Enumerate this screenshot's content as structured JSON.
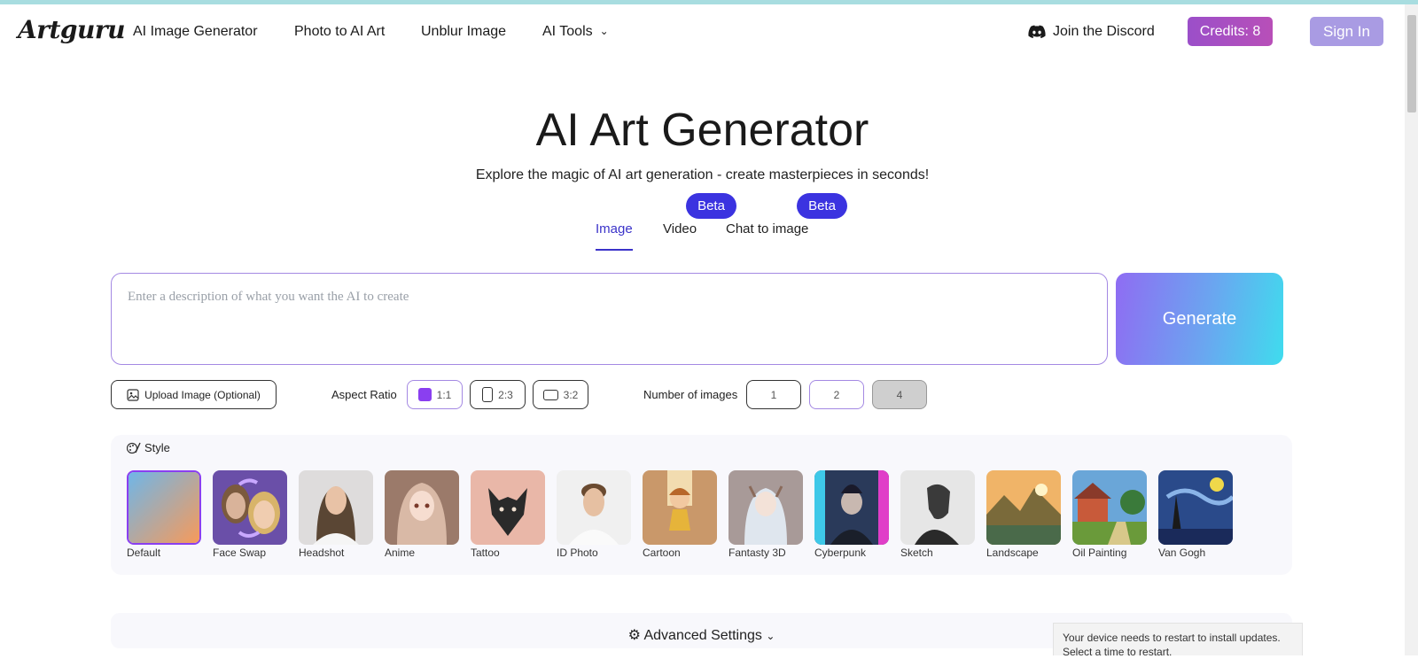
{
  "header": {
    "logo": "Artguru",
    "nav": [
      "AI Image Generator",
      "Photo to AI Art",
      "Unblur Image",
      "AI Tools"
    ],
    "discord_label": "Join the Discord",
    "credits_label": "Credits: 8",
    "signin_label": "Sign In"
  },
  "hero": {
    "title": "AI Art Generator",
    "subtitle": "Explore the magic of AI art generation - create masterpieces in seconds!"
  },
  "tabs": [
    {
      "label": "Image",
      "active": true
    },
    {
      "label": "Video",
      "badge": "Beta"
    },
    {
      "label": "Chat to image",
      "badge": "Beta"
    }
  ],
  "prompt": {
    "placeholder": "Enter a description of what you want the AI to create",
    "value": ""
  },
  "generate_label": "Generate",
  "options": {
    "upload_label": "Upload Image (Optional)",
    "aspect_label": "Aspect Ratio",
    "aspect_ratios": [
      "1:1",
      "2:3",
      "3:2"
    ],
    "aspect_selected": "1:1",
    "count_label": "Number of images",
    "counts": [
      "1",
      "2",
      "4"
    ],
    "count_selected": "2"
  },
  "style": {
    "title": "Style",
    "selected": "Default",
    "items": [
      "Default",
      "Face Swap",
      "Headshot",
      "Anime",
      "Tattoo",
      "ID Photo",
      "Cartoon",
      "Fantasty 3D",
      "Cyberpunk",
      "Sketch",
      "Landscape",
      "Oil Painting",
      "Van Gogh"
    ]
  },
  "advanced_label": "Advanced Settings",
  "toast": {
    "line1": "Your device needs to restart to install updates.",
    "line2": "Select a time to restart."
  },
  "colors": {
    "accent": "#3b33c9",
    "beta": "#3b33e0",
    "selection": "#8a3ff0",
    "credits": "#b84fb8",
    "signin": "#a99be3"
  }
}
